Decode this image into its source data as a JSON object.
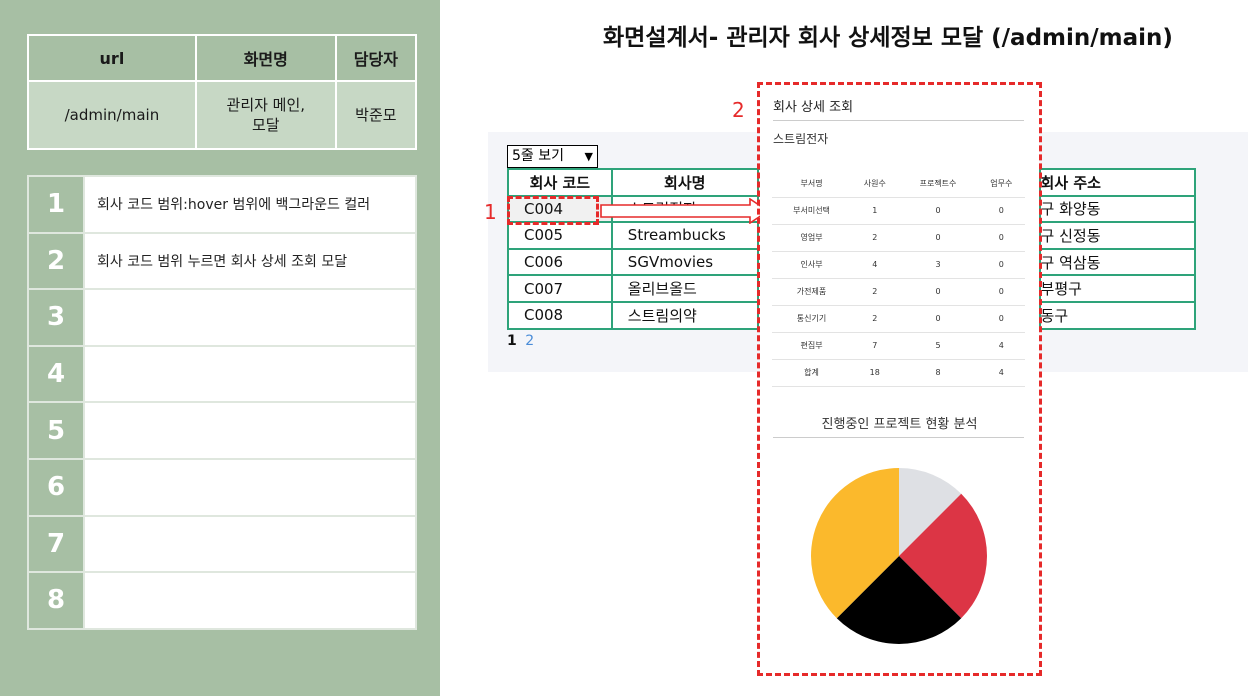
{
  "info": {
    "headers": [
      "url",
      "화면명",
      "담당자"
    ],
    "values": [
      "/admin/main",
      "관리자 메인,\n모달",
      "박준모"
    ]
  },
  "descriptions": [
    {
      "num": "1",
      "text": "회사 코드 범위:hover 범위에 백그라운드 컬러"
    },
    {
      "num": "2",
      "text": "회사 코드 범위 누르면 회사 상세 조회 모달"
    },
    {
      "num": "3",
      "text": ""
    },
    {
      "num": "4",
      "text": ""
    },
    {
      "num": "5",
      "text": ""
    },
    {
      "num": "6",
      "text": ""
    },
    {
      "num": "7",
      "text": ""
    },
    {
      "num": "8",
      "text": ""
    }
  ],
  "title": "화면설계서- 관리자 회사 상세정보 모달 (/admin/main)",
  "list": {
    "page_size_select": "5줄 보기",
    "headers": [
      "회사 코드",
      "회사명",
      "회사 주소"
    ],
    "rows": [
      {
        "code": "C004",
        "name": "스트림전자",
        "addr": "구 화양동"
      },
      {
        "code": "C005",
        "name": "Streambucks",
        "addr": "구 신정동"
      },
      {
        "code": "C006",
        "name": "SGVmovies",
        "addr": "구 역삼동"
      },
      {
        "code": "C007",
        "name": "올리브올드",
        "addr": "부평구"
      },
      {
        "code": "C008",
        "name": "스트림의약",
        "addr": "동구"
      }
    ],
    "pages": [
      "1",
      "2"
    ]
  },
  "annotations": {
    "n1": "1",
    "n2": "2"
  },
  "modal": {
    "title": "회사 상세 조회",
    "company": "스트림전자",
    "table_headers": [
      "부서명",
      "사원수",
      "프로젝트수",
      "업무수"
    ],
    "table_rows": [
      [
        "부서미선택",
        "1",
        "0",
        "0"
      ],
      [
        "영업부",
        "2",
        "0",
        "0"
      ],
      [
        "인사부",
        "4",
        "3",
        "0"
      ],
      [
        "가전제품",
        "2",
        "0",
        "0"
      ],
      [
        "통신기기",
        "2",
        "0",
        "0"
      ],
      [
        "편집부",
        "7",
        "5",
        "4"
      ],
      [
        "합계",
        "18",
        "8",
        "4"
      ]
    ],
    "chart_title": "진행중인 프로젝트 현황 분석"
  },
  "chart_data": {
    "type": "pie",
    "values": [
      12.5,
      25,
      25,
      37.5
    ],
    "colors": [
      "#dee0e4",
      "#dc3545",
      "#000000",
      "#fbb92c"
    ]
  }
}
